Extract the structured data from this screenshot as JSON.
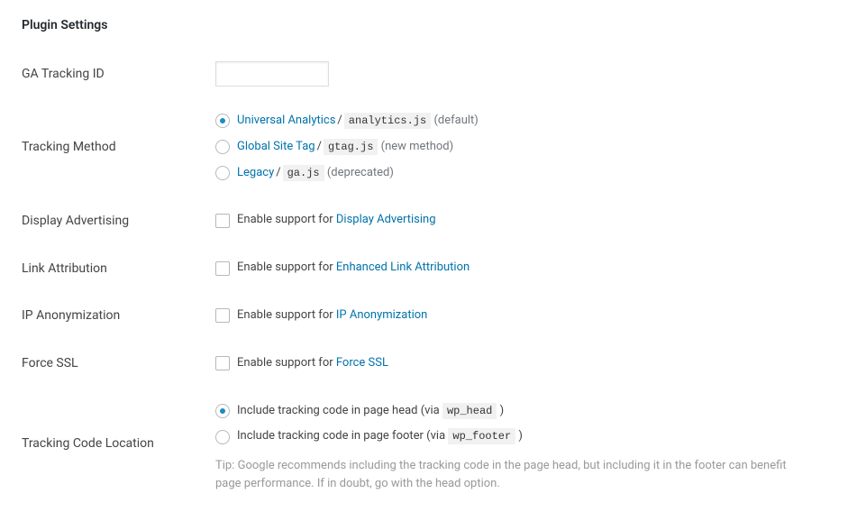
{
  "header": {
    "title": "Plugin Settings"
  },
  "fields": {
    "ga_id": {
      "label": "GA Tracking ID",
      "value": ""
    },
    "tracking_method": {
      "label": "Tracking Method",
      "options": [
        {
          "link": "Universal Analytics",
          "sep": " / ",
          "code": "analytics.js",
          "note": "(default)",
          "checked": true
        },
        {
          "link": "Global Site Tag",
          "sep": " / ",
          "code": "gtag.js",
          "note": "(new method)",
          "checked": false
        },
        {
          "link": "Legacy",
          "sep": " / ",
          "code": "ga.js",
          "note": "(deprecated)",
          "checked": false
        }
      ]
    },
    "display_advertising": {
      "label": "Display Advertising",
      "prefix": "Enable support for ",
      "link": "Display Advertising",
      "checked": false
    },
    "link_attribution": {
      "label": "Link Attribution",
      "prefix": "Enable support for ",
      "link": "Enhanced Link Attribution",
      "checked": false
    },
    "ip_anon": {
      "label": "IP Anonymization",
      "prefix": "Enable support for ",
      "link": "IP Anonymization",
      "checked": false
    },
    "force_ssl": {
      "label": "Force SSL",
      "prefix": "Enable support for ",
      "link": "Force SSL",
      "checked": false
    },
    "location": {
      "label": "Tracking Code Location",
      "options": [
        {
          "text_a": "Include tracking code in page head (via ",
          "code": "wp_head",
          "text_b": " )",
          "checked": true
        },
        {
          "text_a": "Include tracking code in page footer (via ",
          "code": "wp_footer",
          "text_b": " )",
          "checked": false
        }
      ],
      "tip": "Tip: Google recommends including the tracking code in the page head, but including it in the footer can benefit page performance. If in doubt, go with the head option."
    }
  }
}
